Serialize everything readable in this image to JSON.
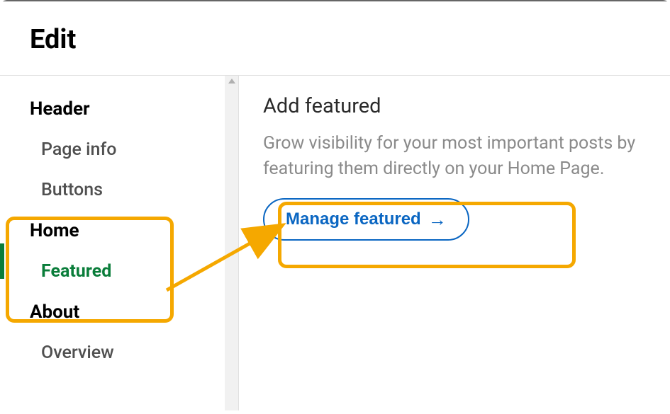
{
  "header": {
    "title": "Edit"
  },
  "sidebar": {
    "sections": [
      {
        "title": "Header",
        "items": [
          {
            "label": "Page info",
            "active": false
          },
          {
            "label": "Buttons",
            "active": false
          }
        ]
      },
      {
        "title": "Home",
        "items": [
          {
            "label": "Featured",
            "active": true
          }
        ]
      },
      {
        "title": "About",
        "items": [
          {
            "label": "Overview",
            "active": false
          }
        ]
      }
    ]
  },
  "main": {
    "title": "Add featured",
    "description": "Grow visibility for your most important posts by featuring them directly on your Home Page.",
    "button_label": "Manage featured"
  }
}
